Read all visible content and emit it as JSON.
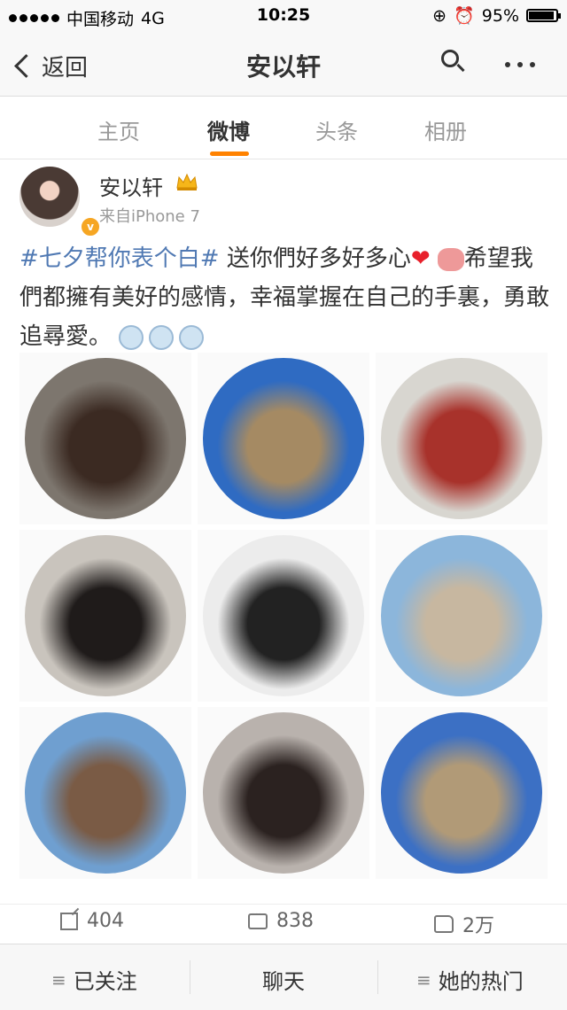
{
  "status": {
    "carrier": "中国移动",
    "network": "4G",
    "time": "10:25",
    "battery": "95%"
  },
  "nav": {
    "back_label": "返回",
    "title": "安以轩"
  },
  "tabs": [
    {
      "label": "主页"
    },
    {
      "label": "微博"
    },
    {
      "label": "头条"
    },
    {
      "label": "相册"
    }
  ],
  "post": {
    "author": "安以轩",
    "source": "来自iPhone 7",
    "hashtag": "#七夕帮你表个白#",
    "text1": " 送你們好多好多心",
    "heart": "❤",
    "text2": "希望我們都擁有美好的感情，幸福掌握在自己的手裏，勇敢追尋愛。",
    "photos": [
      {
        "name": "photo-1",
        "bg": "#7d766e",
        "fg": "#3b2a22"
      },
      {
        "name": "photo-2",
        "bg": "#2f6bc2",
        "fg": "#a58a63"
      },
      {
        "name": "photo-3",
        "bg": "#d8d6d0",
        "fg": "#a8322b"
      },
      {
        "name": "photo-4",
        "bg": "#c9c4bd",
        "fg": "#1f1b1a"
      },
      {
        "name": "photo-5",
        "bg": "#ececec",
        "fg": "#222222"
      },
      {
        "name": "photo-6",
        "bg": "#8cb6db",
        "fg": "#c7b7a0"
      },
      {
        "name": "photo-7",
        "bg": "#6f9fd0",
        "fg": "#7a5b45"
      },
      {
        "name": "photo-8",
        "bg": "#b9b2ad",
        "fg": "#2b2220"
      },
      {
        "name": "photo-9",
        "bg": "#3c70c4",
        "fg": "#b19a77"
      }
    ]
  },
  "actions": {
    "repost": "404",
    "comment": "838",
    "like": "2万"
  },
  "bottom": {
    "follow": "已关注",
    "chat": "聊天",
    "hot": "她的热门"
  },
  "colors": {
    "accent": "#ff8200",
    "link": "#5079b3"
  }
}
